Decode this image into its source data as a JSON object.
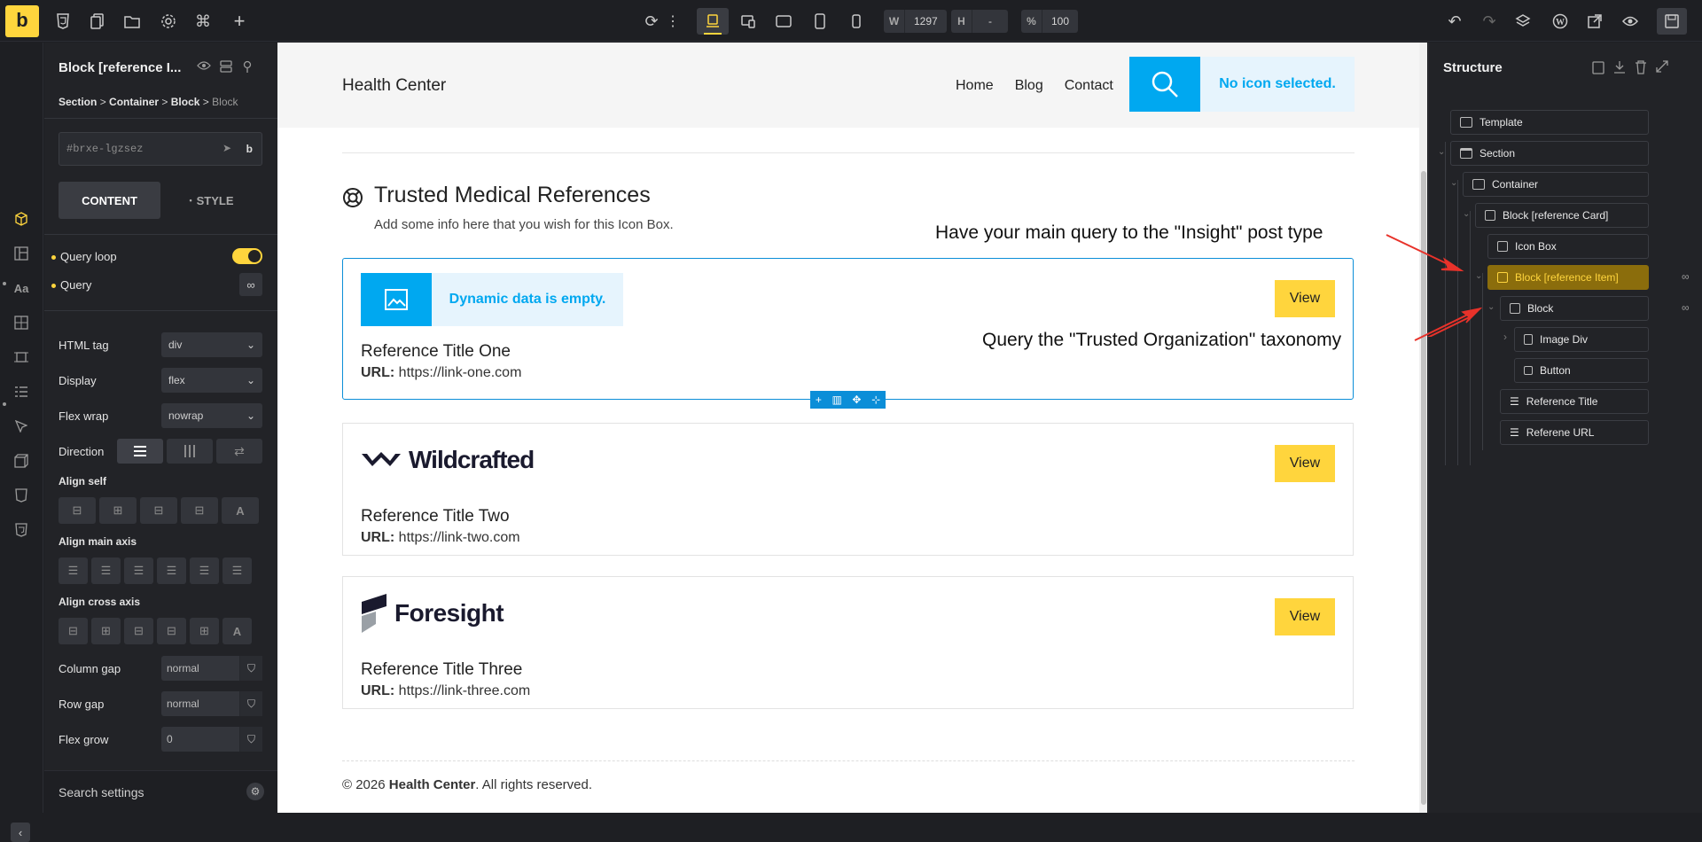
{
  "topbar": {
    "logo": "b",
    "width_label": "W",
    "width_value": "1297",
    "height_label": "H",
    "height_value": "-",
    "zoom_label": "%",
    "zoom_value": "100"
  },
  "left_panel": {
    "title": "Block [reference I...",
    "breadcrumb": {
      "c1": "Section",
      "c2": "Container",
      "c3": "Block",
      "c4": "Block",
      "sep": ">"
    },
    "element_id": "#brxe-lgzsez",
    "tabs": {
      "content": "CONTENT",
      "style": "STYLE"
    },
    "query_loop": "Query loop",
    "query": "Query",
    "html_tag": {
      "label": "HTML tag",
      "value": "div"
    },
    "display": {
      "label": "Display",
      "value": "flex"
    },
    "flex_wrap": {
      "label": "Flex wrap",
      "value": "nowrap"
    },
    "direction": "Direction",
    "align_self": "Align self",
    "align_main": "Align main axis",
    "align_cross": "Align cross axis",
    "column_gap": {
      "label": "Column gap",
      "value": "normal"
    },
    "row_gap": {
      "label": "Row gap",
      "value": "normal"
    },
    "flex_grow": {
      "label": "Flex grow",
      "value": "0"
    },
    "search_placeholder": "Search settings"
  },
  "site": {
    "brand": "Health Center",
    "nav": [
      "Home",
      "Blog",
      "Contact"
    ],
    "no_icon": "No icon selected.",
    "iconbox_title": "Trusted Medical References",
    "iconbox_desc": "Add some info here that you wish for this Icon Box.",
    "dynamic_empty": "Dynamic data is empty.",
    "view_label": "View",
    "url_label": "URL:",
    "cards": [
      {
        "title": "Reference Title One",
        "url": "https://link-one.com"
      },
      {
        "title": "Reference Title Two",
        "url": "https://link-two.com",
        "logo": "Wildcrafted"
      },
      {
        "title": "Reference Title Three",
        "url": "https://link-three.com",
        "logo": "Foresight"
      }
    ],
    "footer": {
      "pre": "© 2026 ",
      "brand": "Health Center",
      "post": ". All rights reserved."
    }
  },
  "structure": {
    "title": "Structure",
    "nodes": [
      "Template",
      "Section",
      "Container",
      "Block [reference Card]",
      "Icon Box",
      "Block [reference Item]",
      "Block",
      "Image Div",
      "Button",
      "Reference Title",
      "Referene URL"
    ]
  },
  "annotations": {
    "a1": "Have your main query to the \"Insight\" post type",
    "a2": "Query the \"Trusted Organization\" taxonomy"
  },
  "colors": {
    "accent": "#ffd53d",
    "blue": "#00a8f0",
    "highlight": "#8b6d0c"
  }
}
